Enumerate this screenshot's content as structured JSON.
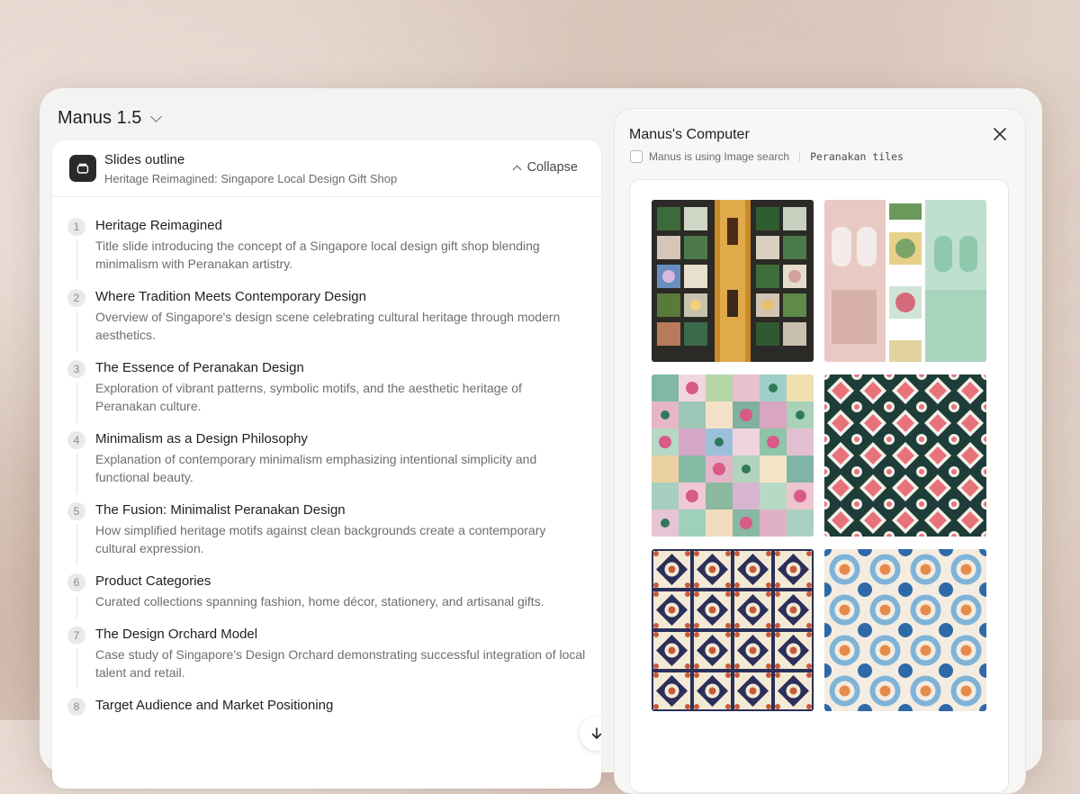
{
  "app": {
    "model_name": "Manus 1.5"
  },
  "outline": {
    "title": "Slides outline",
    "subtitle": "Heritage Reimagined: Singapore Local Design Gift Shop",
    "collapse_label": "Collapse",
    "items": [
      {
        "num": "1",
        "title": "Heritage Reimagined",
        "desc": "Title slide introducing the concept of a Singapore local design gift shop blending minimalism with Peranakan artistry."
      },
      {
        "num": "2",
        "title": "Where Tradition Meets Contemporary Design",
        "desc": "Overview of Singapore's design scene celebrating cultural heritage through modern aesthetics."
      },
      {
        "num": "3",
        "title": "The Essence of Peranakan Design",
        "desc": "Exploration of vibrant patterns, symbolic motifs, and the aesthetic heritage of Peranakan culture."
      },
      {
        "num": "4",
        "title": "Minimalism as a Design Philosophy",
        "desc": "Explanation of contemporary minimalism emphasizing intentional simplicity and functional beauty."
      },
      {
        "num": "5",
        "title": "The Fusion: Minimalist Peranakan Design",
        "desc": "How simplified heritage motifs against clean backgrounds create a contemporary cultural expression."
      },
      {
        "num": "6",
        "title": "Product Categories",
        "desc": "Curated collections spanning fashion, home décor, stationery, and artisanal gifts."
      },
      {
        "num": "7",
        "title": "The Design Orchard Model",
        "desc": "Case study of Singapore's Design Orchard demonstrating successful integration of local talent and retail."
      },
      {
        "num": "8",
        "title": "Target Audience and Market Positioning",
        "desc": ""
      }
    ]
  },
  "computer": {
    "title": "Manus's Computer",
    "status_text": "Manus is using Image search",
    "query": "Peranakan tiles",
    "images": [
      {
        "name": "tile-panels-shop"
      },
      {
        "name": "shophouse-facade"
      },
      {
        "name": "floral-tile-collage"
      },
      {
        "name": "coral-green-pattern"
      },
      {
        "name": "navy-cream-tiles"
      },
      {
        "name": "blue-orange-tiles"
      }
    ]
  },
  "colors": {
    "accent_dark": "#2a2a2a",
    "muted_text": "#6e6e6e",
    "panel_bg": "#f7f7f6"
  },
  "icons": {
    "model_dropdown": "chevron-down-icon",
    "app": "layers-icon",
    "collapse": "chevron-up-icon",
    "close": "close-icon",
    "scroll": "arrow-down-icon"
  }
}
